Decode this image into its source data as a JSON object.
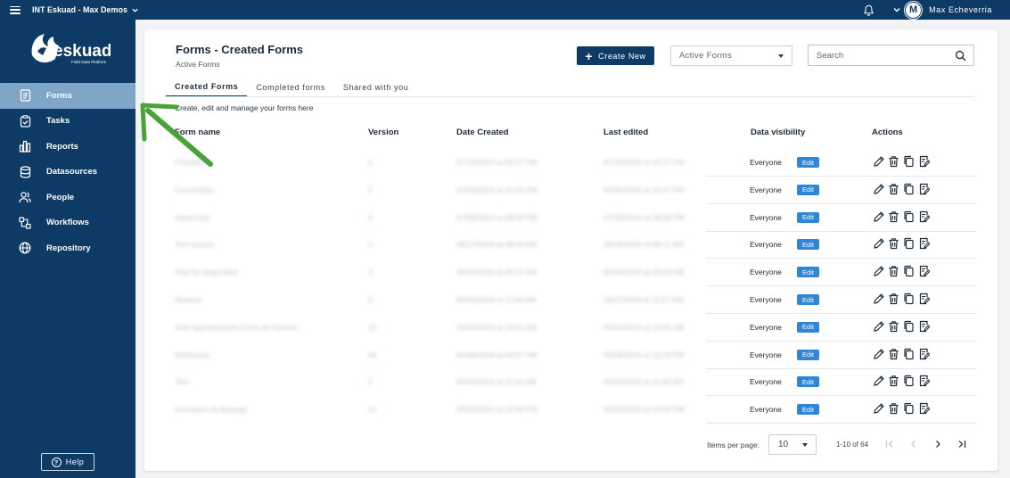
{
  "topbar": {
    "org_name": "INT Eskuad - Max Demos",
    "avatar_initial": "M",
    "user_name": "Max Echeverria"
  },
  "sidebar": {
    "logo_text": "eskuad",
    "logo_tagline": "Field Data Platform",
    "items": [
      {
        "label": "Forms",
        "icon": "forms-icon",
        "active": true
      },
      {
        "label": "Tasks",
        "icon": "tasks-icon",
        "active": false
      },
      {
        "label": "Reports",
        "icon": "reports-icon",
        "active": false
      },
      {
        "label": "Datasources",
        "icon": "database-icon",
        "active": false
      },
      {
        "label": "People",
        "icon": "people-icon",
        "active": false
      },
      {
        "label": "Workflows",
        "icon": "workflows-icon",
        "active": false
      },
      {
        "label": "Repository",
        "icon": "globe-icon",
        "active": false
      }
    ],
    "help_label": "Help"
  },
  "header": {
    "title": "Forms - Created Forms",
    "subtitle": "Active Forms",
    "create_label": "Create New",
    "filter_value": "Active Forms",
    "search_placeholder": "Search"
  },
  "tabs": [
    {
      "label": "Created Forms",
      "active": true
    },
    {
      "label": "Completed forms",
      "active": false
    },
    {
      "label": "Shared with you",
      "active": false
    }
  ],
  "helper_text": "Create, edit and manage your forms here",
  "table": {
    "columns": [
      "Form name",
      "Version",
      "Date Created",
      "Last edited",
      "Data visibility",
      "Actions"
    ],
    "edit_label": "Edit",
    "rows": [
      {
        "name": "Checklist",
        "version": "2",
        "created": "07/15/2024 at 04:57 PM",
        "edited": "07/15/2024 at 05:17 PM",
        "visibility": "Everyone"
      },
      {
        "name": "Contenedor",
        "version": "2",
        "created": "07/03/2024 at 10:43 PM",
        "edited": "07/05/2024 at 10:47 PM",
        "visibility": "Everyone"
      },
      {
        "name": "Inspeccion",
        "version": "3",
        "created": "07/09/2024 at 08:08 PM",
        "edited": "07/09/2024 at 08:58 PM",
        "visibility": "Everyone"
      },
      {
        "name": "Test Access",
        "version": "1",
        "created": "06/17/2024 at 08:43 AM",
        "edited": "06/19/2024 at 09:11 AM",
        "visibility": "Everyone"
      },
      {
        "name": "Test De Seguridad",
        "version": "3",
        "created": "06/08/2024 at 05:57 AM",
        "edited": "06/06/2024 at 05:53 AM",
        "visibility": "Everyone"
      },
      {
        "name": "Muestra",
        "version": "5",
        "created": "06/26/2024 at 11:56 AM",
        "edited": "06/27/2024 at 11:57 AM",
        "visibility": "Everyone"
      },
      {
        "name": "Visit Agendamiento Form de Servicio",
        "version": "12",
        "created": "05/20/2024 at 10:01 AM",
        "edited": "05/22/2024 at 10:05 AM",
        "visibility": "Everyone"
      },
      {
        "name": "Reference",
        "version": "24",
        "created": "05/06/2024 at 04:57 PM",
        "edited": "05/08/2024 at 10:23 PM",
        "visibility": "Everyone"
      },
      {
        "name": "Test",
        "version": "2",
        "created": "05/03/2024 at 11:56 AM",
        "edited": "05/03/2024 at 11:44 AM",
        "visibility": "Everyone"
      },
      {
        "name": "Inventario de Bodega",
        "version": "12",
        "created": "05/02/2024 at 03:46 PM",
        "edited": "05/02/2024 at 03:46 PM",
        "visibility": "Everyone"
      }
    ]
  },
  "pagination": {
    "label": "Items per page:",
    "per_page": "10",
    "range": "1-10 of 64"
  },
  "colors": {
    "primary": "#0d3b66",
    "active_nav": "#7fa6c9",
    "edit_badge": "#2f86d6",
    "annotation_arrow": "#4aa33a"
  }
}
